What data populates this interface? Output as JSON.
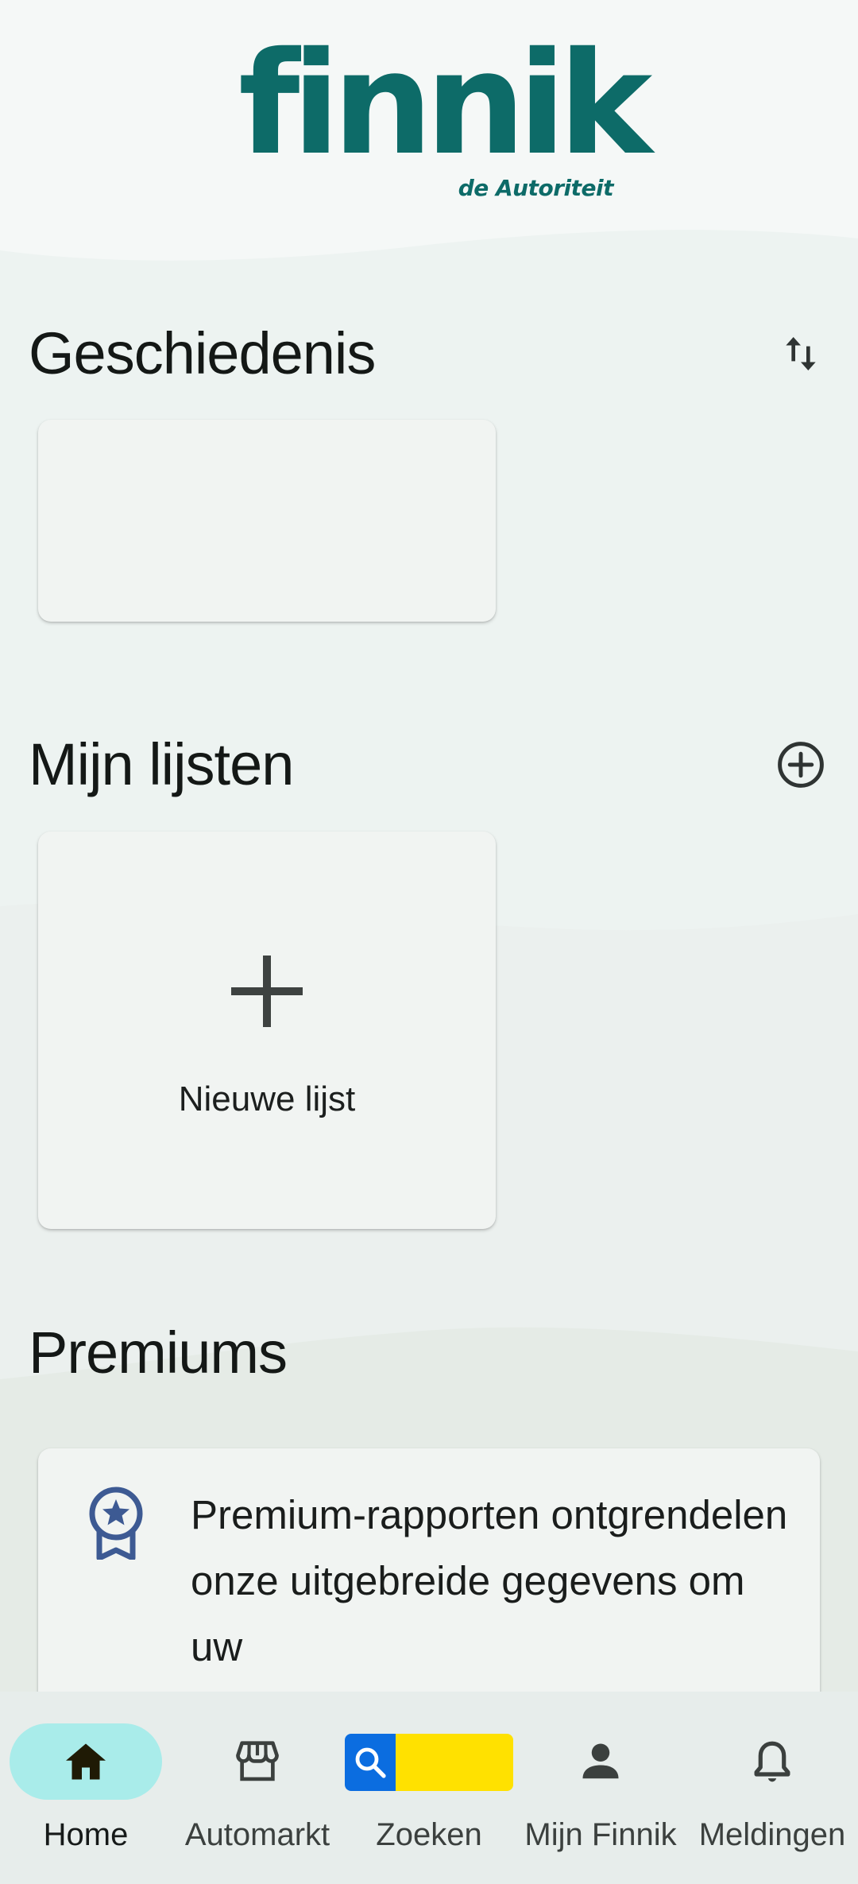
{
  "brand": {
    "name": "finnik",
    "tagline": "de Autoriteit",
    "brand_color": "#0d6b68"
  },
  "sections": {
    "history": {
      "title": "Geschiedenis",
      "action_icon": "sort-arrows-icon"
    },
    "lists": {
      "title": "Mijn lijsten",
      "action_icon": "add-circle-icon",
      "new_list_label": "Nieuwe lijst"
    },
    "premiums": {
      "title": "Premiums",
      "icon": "award-badge-icon",
      "description": "Premium-rapporten ontgrendelen onze uitgebreide gegevens om uw"
    }
  },
  "bottom_nav": {
    "items": [
      {
        "label": "Home",
        "icon": "home-icon",
        "active": true
      },
      {
        "label": "Automarkt",
        "icon": "storefront-icon",
        "active": false
      },
      {
        "label": "Zoeken",
        "icon": "search-icon",
        "active": false
      },
      {
        "label": "Mijn Finnik",
        "icon": "person-icon",
        "active": false
      },
      {
        "label": "Meldingen",
        "icon": "bell-icon",
        "active": false
      }
    ],
    "active_pill_color": "#a9ecea",
    "search_colors": {
      "blue": "#0b6de0",
      "yellow": "#ffe100"
    }
  }
}
